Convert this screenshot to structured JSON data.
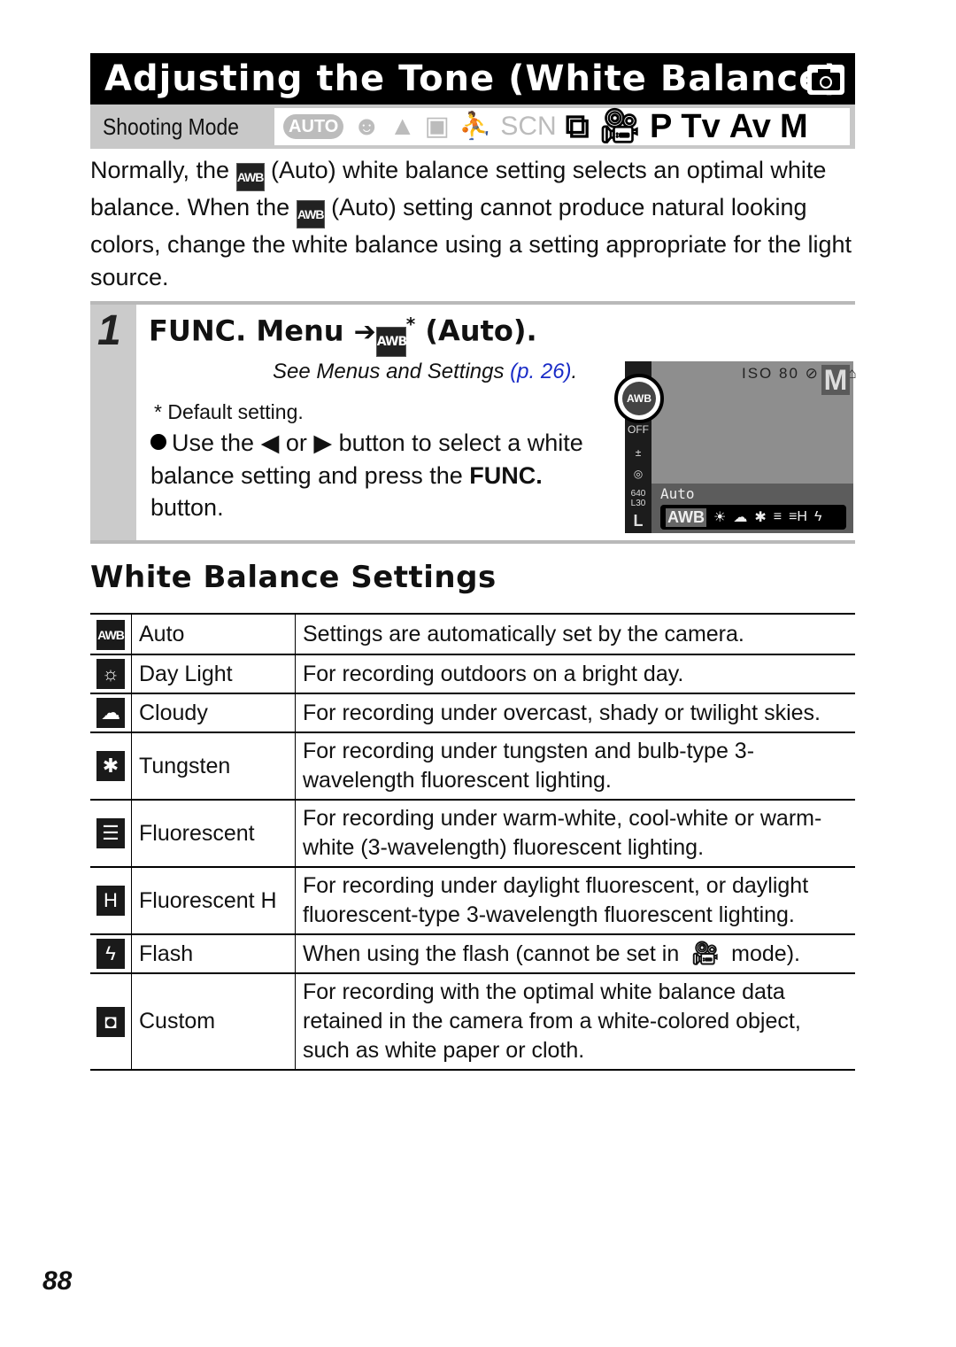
{
  "header": {
    "title": "Adjusting the Tone (White Balance)",
    "title_icon": "camera-icon",
    "shooting_mode_label": "Shooting Mode",
    "modes": [
      {
        "label": "AUTO",
        "icon": "auto-mode-icon",
        "available": false
      },
      {
        "label": "",
        "icon": "portrait-mode-icon",
        "available": false
      },
      {
        "label": "",
        "icon": "landscape-mode-icon",
        "available": false
      },
      {
        "label": "",
        "icon": "special-scene-icon",
        "available": false
      },
      {
        "label": "",
        "icon": "sports-mode-icon",
        "available": false
      },
      {
        "label": "SCN",
        "icon": "scn-mode-icon",
        "available": false
      },
      {
        "label": "",
        "icon": "stitch-assist-icon",
        "available": true
      },
      {
        "label": "",
        "icon": "movie-mode-icon",
        "available": true
      },
      {
        "label": "P",
        "icon": "p-mode-icon",
        "available": true
      },
      {
        "label": "Tv",
        "icon": "tv-mode-icon",
        "available": true
      },
      {
        "label": "Av",
        "icon": "av-mode-icon",
        "available": true
      },
      {
        "label": "M",
        "icon": "m-mode-icon",
        "available": true
      }
    ]
  },
  "intro": {
    "p1": "Normally, the ",
    "awb": "AWB",
    "p2": " (Auto) white balance setting selects an optimal white balance. When the ",
    "p3": " (Auto) setting cannot produce natural looking colors, change the white balance using a setting appropriate for the light source."
  },
  "step": {
    "number": "1",
    "title_prefix": "FUNC. Menu",
    "arrow": "➔",
    "awb": "AWB",
    "asterisk": "*",
    "title_suffix": "(Auto).",
    "see_text": "See Menus and Settings ",
    "see_link": "(p. 26)",
    "see_end": ".",
    "default_note": "* Default setting.",
    "bullet_a": "Use the ",
    "left_arrow": "◀",
    "bullet_or": " or ",
    "right_arrow": "▶",
    "bullet_b": " button to select a white balance setting and press the ",
    "func_bold": "FUNC.",
    "bullet_c": " button."
  },
  "lcd": {
    "selected_label": "AWB",
    "mode_letter": "M",
    "top_icons": "ISO 80 ⊘ ▢ ⌂",
    "left_icons": [
      "OFF",
      "±",
      "◎",
      "640 L30",
      "L"
    ],
    "current_setting": "Auto",
    "strip": [
      "AWB",
      "☀",
      "☁",
      "✱",
      "≡",
      "≡H",
      "ϟ"
    ]
  },
  "section": {
    "heading": "White Balance Settings"
  },
  "table": {
    "rows": [
      {
        "icon": "awb-icon",
        "glyph": "AWB",
        "name": "Auto",
        "desc": "Settings are automatically set by the camera."
      },
      {
        "icon": "daylight-icon",
        "glyph": "☼",
        "name": "Day Light",
        "desc": "For recording outdoors on a bright day."
      },
      {
        "icon": "cloudy-icon",
        "glyph": "☁",
        "name": "Cloudy",
        "desc": "For recording under overcast, shady or twilight skies."
      },
      {
        "icon": "tungsten-icon",
        "glyph": "✱",
        "name": "Tungsten",
        "desc": "For recording under tungsten and bulb-type 3-wavelength fluorescent lighting."
      },
      {
        "icon": "fluorescent-icon",
        "glyph": "☰",
        "name": "Fluorescent",
        "desc": "For recording under warm-white, cool-white or warm-white (3-wavelength) fluorescent lighting."
      },
      {
        "icon": "fluorescent-h-icon",
        "glyph": "H",
        "name": "Fluorescent H",
        "desc": "For recording under daylight fluorescent, or daylight fluorescent-type 3-wavelength fluorescent lighting."
      },
      {
        "icon": "flash-icon",
        "glyph": "ϟ",
        "name": "Flash",
        "desc_a": "When using the flash (cannot be set in ",
        "desc_icon": "movie-mode-icon",
        "desc_b": " mode)."
      },
      {
        "icon": "custom-icon",
        "glyph": "◘",
        "name": "Custom",
        "desc": "For recording with the optimal white balance data retained in the camera from a white-colored object, such as white paper or cloth."
      }
    ]
  },
  "footer": {
    "page_number": "88"
  }
}
